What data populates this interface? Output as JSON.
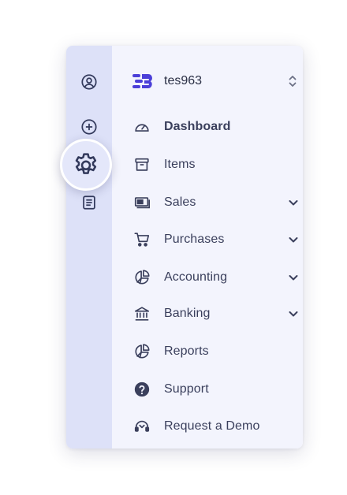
{
  "colors": {
    "rail_bg": "#dde1f8",
    "menu_bg": "#f3f4fd",
    "accent": "#4b3fd8",
    "text": "#3a3f5c"
  },
  "rail": {
    "items": [
      {
        "icon": "user-circle-icon"
      },
      {
        "icon": "plus-circle-icon"
      },
      {
        "icon": "gear-icon",
        "highlighted": true
      },
      {
        "icon": "document-icon"
      }
    ]
  },
  "org": {
    "name": "tes963",
    "logo_icon": "brand-logo-icon",
    "switch_icon": "chevron-up-down-icon"
  },
  "menu": {
    "items": [
      {
        "label": "Dashboard",
        "icon": "speedometer-icon",
        "active": true,
        "expandable": false
      },
      {
        "label": "Items",
        "icon": "archive-box-icon",
        "active": false,
        "expandable": false
      },
      {
        "label": "Sales",
        "icon": "cash-icon",
        "active": false,
        "expandable": true
      },
      {
        "label": "Purchases",
        "icon": "cart-icon",
        "active": false,
        "expandable": true
      },
      {
        "label": "Accounting",
        "icon": "pie-chart-icon",
        "active": false,
        "expandable": true
      },
      {
        "label": "Banking",
        "icon": "bank-icon",
        "active": false,
        "expandable": true
      },
      {
        "label": "Reports",
        "icon": "pie-chart-icon",
        "active": false,
        "expandable": false
      },
      {
        "label": "Support",
        "icon": "question-circle-icon",
        "active": false,
        "expandable": false
      },
      {
        "label": "Request a Demo",
        "icon": "headset-icon",
        "active": false,
        "expandable": false
      }
    ]
  }
}
